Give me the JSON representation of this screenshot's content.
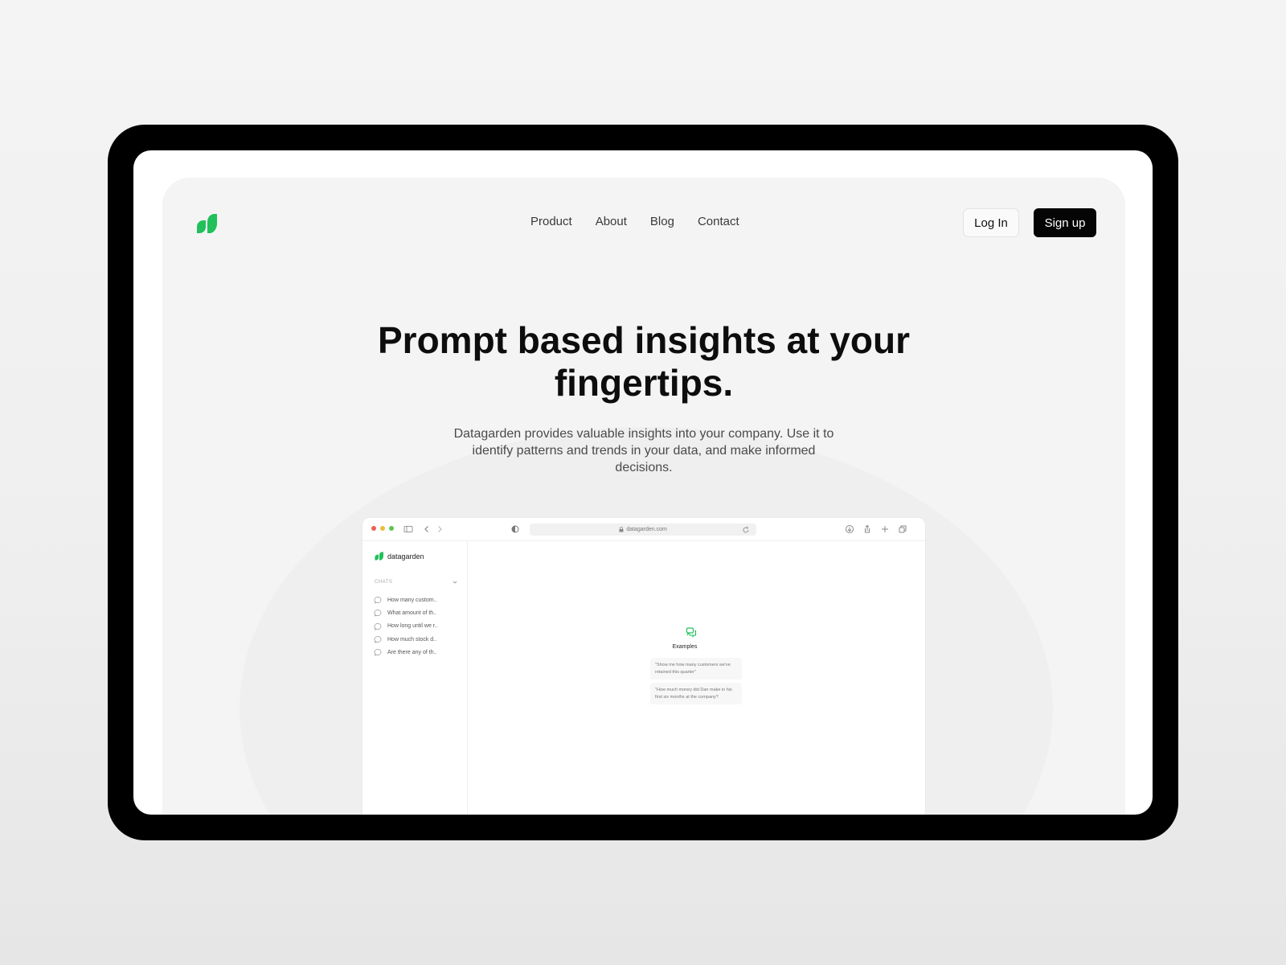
{
  "nav": {
    "links": [
      "Product",
      "About",
      "Blog",
      "Contact"
    ],
    "login_label": "Log In",
    "signup_label": "Sign up"
  },
  "hero": {
    "title": "Prompt based insights at your fingertips.",
    "subtitle": "Datagarden provides valuable insights into your company. Use it to identify patterns and trends in your data, and make informed decisions."
  },
  "browser": {
    "url": "datagarden.com",
    "traffic_lights": [
      "#ec5f57",
      "#e9bf3d",
      "#5fc454"
    ],
    "toolbar_icons": [
      "sidebar-icon",
      "back-icon",
      "forward-icon",
      "shield-icon",
      "reload-icon",
      "download-icon",
      "share-icon",
      "plus-icon",
      "tabs-icon"
    ]
  },
  "app": {
    "brand": "datagarden",
    "chats_label": "CHATS",
    "chats": [
      "How many custom..",
      "What amount of th..",
      "How long until we r..",
      "How much stock d..",
      "Are there any of th.."
    ],
    "examples_label": "Examples",
    "examples": [
      "\"Show me how many customers we've retained this quarter\"",
      "\"How much money did Dan make in his first six months at the company?"
    ]
  },
  "colors": {
    "brand_green": "#21c05a",
    "signup_bg": "#050505",
    "device_frame": "#000000"
  }
}
